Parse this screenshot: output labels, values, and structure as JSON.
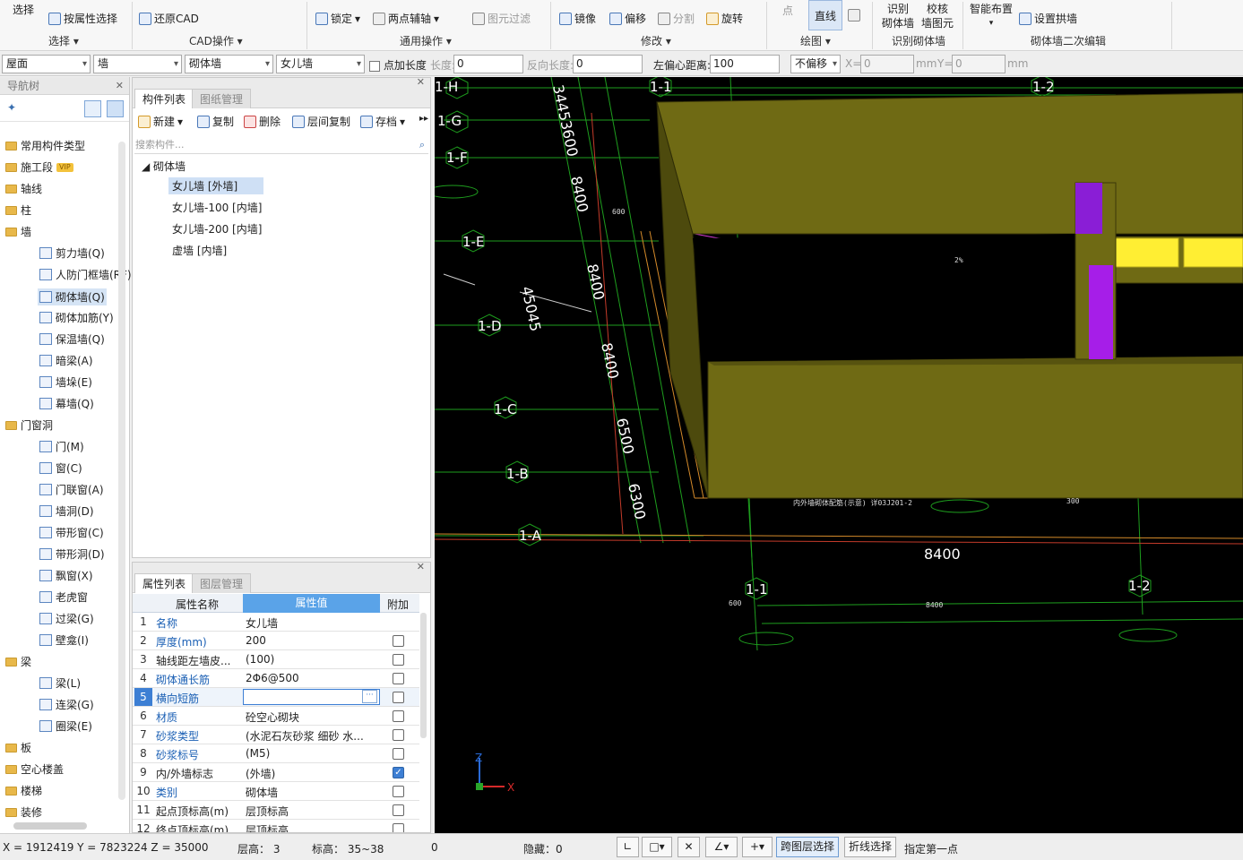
{
  "ribbon": {
    "select_label": "选择",
    "attr_select": "按属性选择",
    "restore_cad": "还原CAD",
    "lock": "锁定",
    "two_point_axis": "两点辅轴",
    "element_filter": "图元过滤",
    "mirror": "镜像",
    "offset": "偏移",
    "split": "分割",
    "rotate": "旋转",
    "point": "点",
    "line": "直线",
    "identify_1": "识别",
    "identify_2": "砌体墙",
    "check_1": "校核",
    "check_2": "墙图元",
    "smart_layout": "智能布置",
    "set_arch_wall": "设置拱墙",
    "groups": {
      "select": "选择",
      "cad": "CAD操作",
      "common": "通用操作",
      "modify": "修改",
      "draw": "绘图",
      "identify": "识别砌体墙",
      "secondary": "砌体墙二次编辑"
    }
  },
  "parambar": {
    "floor": "屋面",
    "category": "墙",
    "type": "砌体墙",
    "name": "女儿墙",
    "point_length": "点加长度",
    "length_label": "长度:",
    "length_value": "0",
    "reverse_label": "反向长度:",
    "reverse_value": "0",
    "left_offset_label": "左偏心距离:",
    "left_offset_value": "100",
    "no_offset": "不偏移",
    "x_label": "X=",
    "x_value": "0",
    "mm1": "mm",
    "y_label": "Y=",
    "y_value": "0",
    "mm2": "mm"
  },
  "nav": {
    "title": "导航树",
    "items": [
      {
        "label": "常用构件类型"
      },
      {
        "label": "施工段",
        "badge": "VIP"
      },
      {
        "label": "轴线"
      },
      {
        "label": "柱"
      },
      {
        "label": "墙"
      },
      {
        "label": "剪力墙(Q)"
      },
      {
        "label": "人防门框墙(RF)"
      },
      {
        "label": "砌体墙(Q)"
      },
      {
        "label": "砌体加筋(Y)"
      },
      {
        "label": "保温墙(Q)"
      },
      {
        "label": "暗梁(A)"
      },
      {
        "label": "墙垛(E)"
      },
      {
        "label": "幕墙(Q)"
      },
      {
        "label": "门窗洞"
      },
      {
        "label": "门(M)"
      },
      {
        "label": "窗(C)"
      },
      {
        "label": "门联窗(A)"
      },
      {
        "label": "墙洞(D)"
      },
      {
        "label": "带形窗(C)"
      },
      {
        "label": "带形洞(D)"
      },
      {
        "label": "飘窗(X)"
      },
      {
        "label": "老虎窗"
      },
      {
        "label": "过梁(G)"
      },
      {
        "label": "壁龛(I)"
      },
      {
        "label": "梁"
      },
      {
        "label": "梁(L)"
      },
      {
        "label": "连梁(G)"
      },
      {
        "label": "圈梁(E)"
      },
      {
        "label": "板"
      },
      {
        "label": "空心楼盖"
      },
      {
        "label": "楼梯"
      },
      {
        "label": "装修"
      }
    ]
  },
  "components": {
    "tab_list": "构件列表",
    "tab_drawings": "图纸管理",
    "new": "新建",
    "copy": "复制",
    "delete": "删除",
    "floor_copy": "层间复制",
    "save": "存档",
    "search_placeholder": "搜索构件...",
    "group": "砌体墙",
    "items": [
      "女儿墙 [外墙]",
      "女儿墙-100 [内墙]",
      "女儿墙-200 [内墙]",
      "虚墙 [内墙]"
    ]
  },
  "properties": {
    "tab_props": "属性列表",
    "tab_layers": "图层管理",
    "col_name": "属性名称",
    "col_value": "属性值",
    "col_extra": "附加",
    "rows": [
      {
        "n": "1",
        "name": "名称",
        "value": "女儿墙",
        "check": null
      },
      {
        "n": "2",
        "name": "厚度(mm)",
        "value": "200",
        "check": false
      },
      {
        "n": "3",
        "name": "轴线距左墙皮...",
        "value": "(100)",
        "check": false
      },
      {
        "n": "4",
        "name": "砌体通长筋",
        "value": "2Φ6@500",
        "check": false
      },
      {
        "n": "5",
        "name": "横向短筋",
        "value": "",
        "check": false
      },
      {
        "n": "6",
        "name": "材质",
        "value": "砼空心砌块",
        "check": false
      },
      {
        "n": "7",
        "name": "砂浆类型",
        "value": "(水泥石灰砂浆 细砂 水...",
        "check": false
      },
      {
        "n": "8",
        "name": "砂浆标号",
        "value": "(M5)",
        "check": false
      },
      {
        "n": "9",
        "name": "内/外墙标志",
        "value": "(外墙)",
        "check": true
      },
      {
        "n": "10",
        "name": "类别",
        "value": "砌体墙",
        "check": false
      },
      {
        "n": "11",
        "name": "起点顶标高(m)",
        "value": "层顶标高",
        "check": false
      },
      {
        "n": "12",
        "name": "终点顶标高(m)",
        "value": "层顶标高",
        "check": false
      }
    ]
  },
  "canvas": {
    "axes": [
      "1-H",
      "1-G",
      "1-F",
      "1-E",
      "1-D",
      "1-C",
      "1-B",
      "1-A"
    ],
    "top_axes": [
      "1-1",
      "1-2"
    ],
    "bottom_axes": [
      "1-1",
      "1-2"
    ],
    "dims": [
      "34453600",
      "8400",
      "8400",
      "45045",
      "8400",
      "6500",
      "6300",
      "8400"
    ],
    "axis_x": "X",
    "axis_z": "Z"
  },
  "status": {
    "coords": "X = 1912419 Y = 7823224 Z = 35000",
    "floor_height": "层高： 3",
    "elevation": "标高： 35~38",
    "zero": "0",
    "hidden": "隐藏：0",
    "cross_layer": "跨图层选择",
    "polyline": "折线选择",
    "prompt": "指定第一点"
  }
}
